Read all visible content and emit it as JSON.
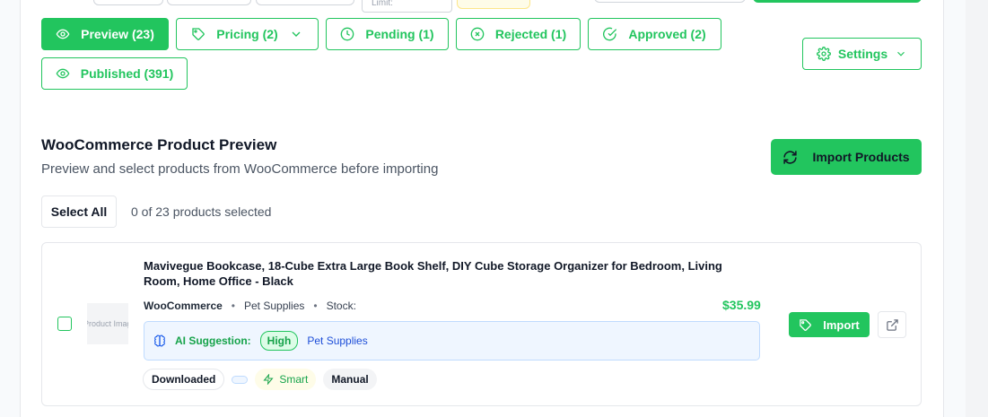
{
  "top": {
    "limit_label": "Limit:"
  },
  "filters": [
    {
      "label": "Preview (23)",
      "icon": "eye-icon",
      "active": true
    },
    {
      "label": "Pricing (2)",
      "icon": "tag-icon",
      "active": false
    },
    {
      "label": "Pending (1)",
      "icon": "clock-icon",
      "active": false
    },
    {
      "label": "Rejected (1)",
      "icon": "x-circle-icon",
      "active": false
    },
    {
      "label": "Approved (2)",
      "icon": "check-circle-icon",
      "active": false
    },
    {
      "label": "Published (391)",
      "icon": "eye-icon",
      "active": false
    }
  ],
  "settings": {
    "label": "Settings",
    "icon": "gear-icon"
  },
  "section": {
    "title": "WooCommerce Product Preview",
    "subtitle": "Preview and select products from WooCommerce before importing",
    "import_button": "Import Products"
  },
  "selection": {
    "select_all": "Select All",
    "count_text": "0 of 23 products selected"
  },
  "product": {
    "image_alt": "Product Image",
    "title": "Mavivegue Bookcase, 18-Cube Extra Large Book Shelf, DIY Cube Storage Organizer for Bedroom, Living Room, Home Office - Black",
    "source": "WooCommerce",
    "category": "Pet Supplies",
    "stock_label": "Stock:",
    "price": "$35.99",
    "ai": {
      "label": "AI Suggestion:",
      "confidence": "High",
      "category": "Pet Supplies"
    },
    "tags": {
      "downloaded": "Downloaded",
      "smart": "Smart",
      "manual": "Manual"
    },
    "import_label": "Import"
  },
  "colors": {
    "accent": "#22c55e",
    "ai_bg": "#eff6ff",
    "ai_border": "#bfdbfe",
    "link": "#1d4ed8"
  }
}
